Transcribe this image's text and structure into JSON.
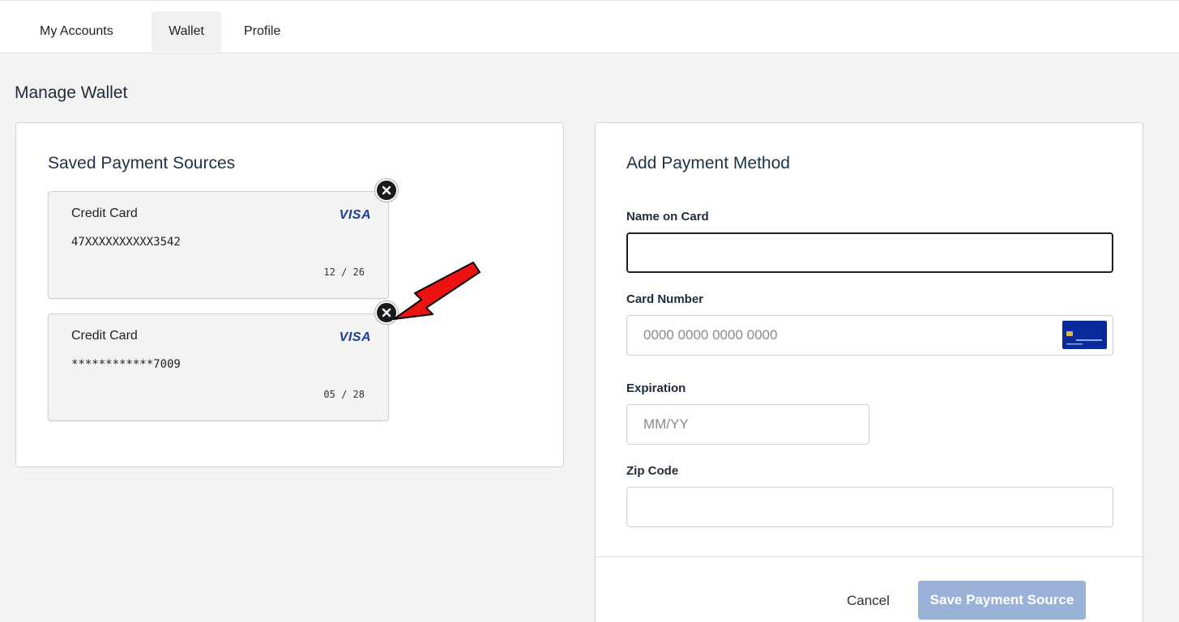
{
  "nav": {
    "tabs": [
      {
        "label": "My Accounts"
      },
      {
        "label": "Wallet",
        "active": true
      },
      {
        "label": "Profile"
      }
    ]
  },
  "page": {
    "title": "Manage Wallet"
  },
  "saved_sources": {
    "heading": "Saved Payment Sources",
    "cards": [
      {
        "type": "Credit Card",
        "brand": "VISA",
        "number": "47XXXXXXXXXX3542",
        "expiry": "12 / 26"
      },
      {
        "type": "Credit Card",
        "brand": "VISA",
        "number": "************7009",
        "expiry": "05 / 28"
      }
    ]
  },
  "add_method": {
    "heading": "Add Payment Method",
    "name_label": "Name on Card",
    "name_value": "",
    "card_number_label": "Card Number",
    "card_number_placeholder": "0000 0000 0000 0000",
    "expiration_label": "Expiration",
    "expiration_placeholder": "MM/YY",
    "zip_label": "Zip Code",
    "zip_value": "",
    "cancel_label": "Cancel",
    "save_label": "Save Payment Source"
  },
  "icons": {
    "remove": "close-circle-icon",
    "card_input": "credit-card-icon",
    "annotation": "red-arrow"
  },
  "colors": {
    "brand_blue": "#1a3f9a",
    "save_button": "#9bb2d8",
    "arrow_red": "#ee1111"
  }
}
